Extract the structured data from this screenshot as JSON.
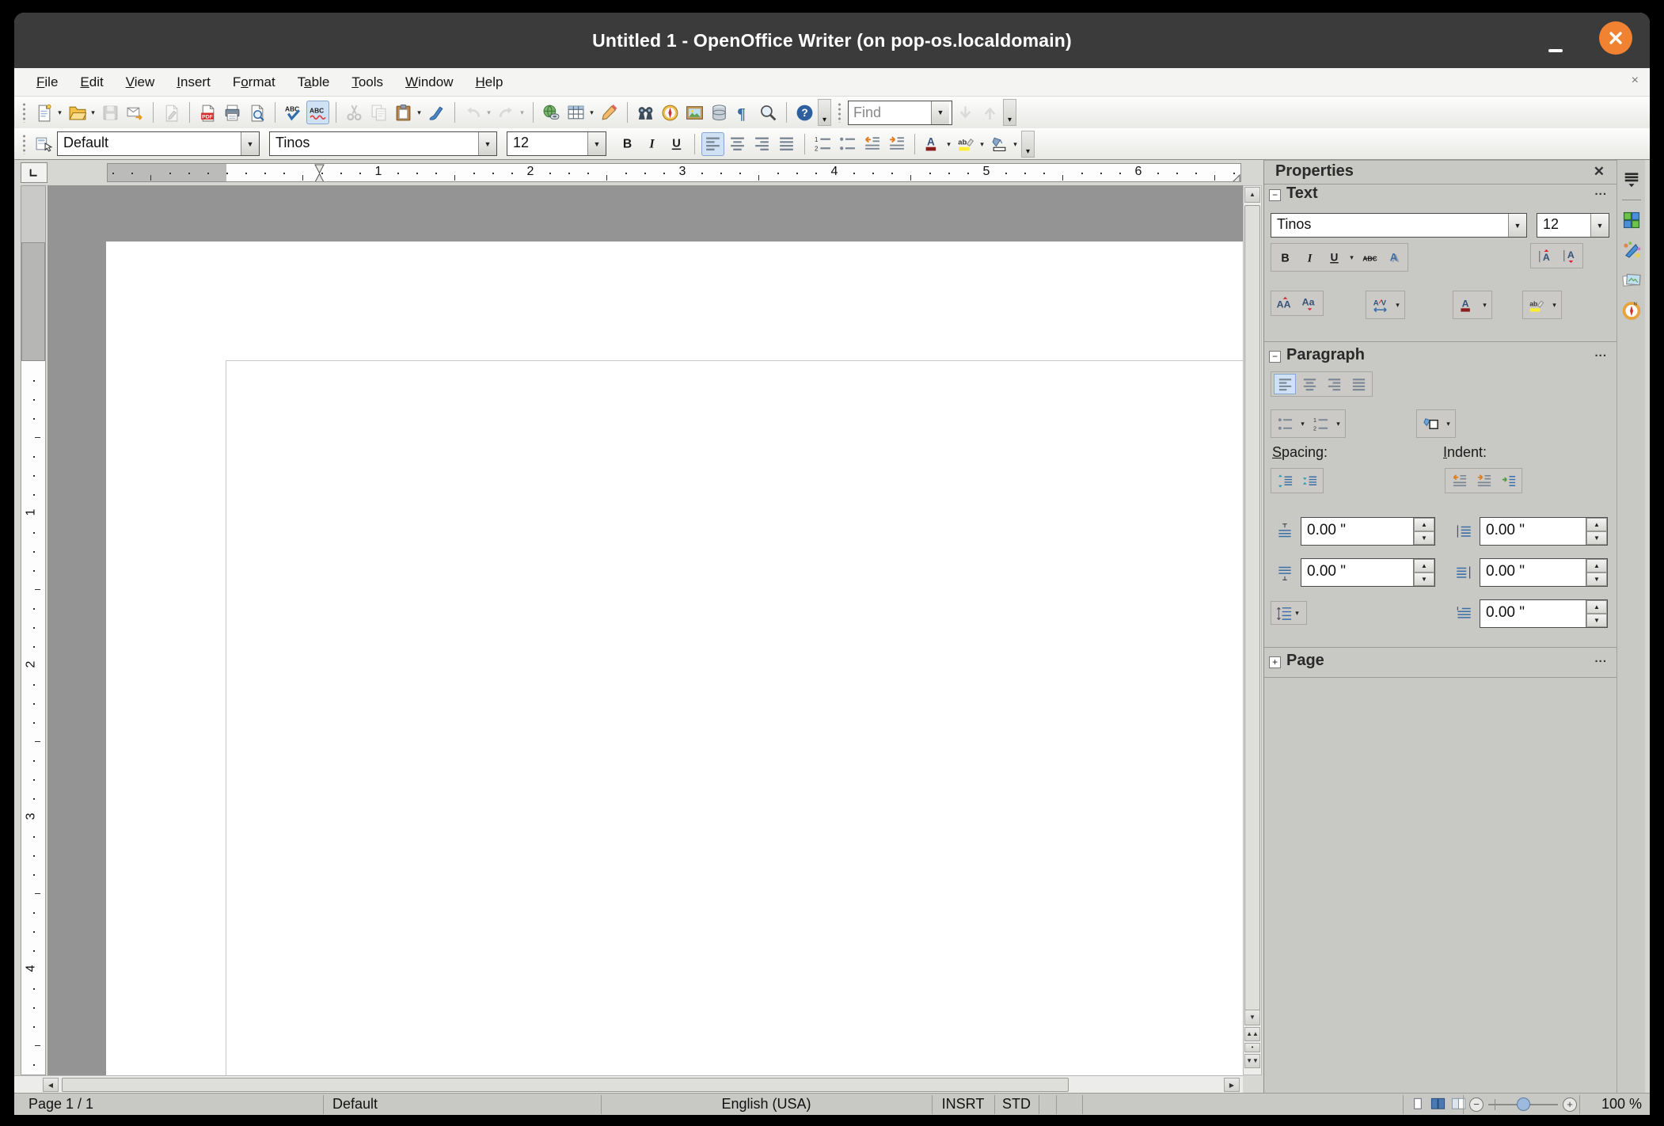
{
  "window": {
    "title": "Untitled 1 - OpenOffice Writer (on pop-os.localdomain)",
    "accent_close_color": "#f08232",
    "titlebar_color": "#3b3b3b"
  },
  "menubar": {
    "items": [
      {
        "label": "File",
        "u": 0
      },
      {
        "label": "Edit",
        "u": 0
      },
      {
        "label": "View",
        "u": 0
      },
      {
        "label": "Insert",
        "u": 0
      },
      {
        "label": "Format",
        "u": 1
      },
      {
        "label": "Table",
        "u": 1
      },
      {
        "label": "Tools",
        "u": 0
      },
      {
        "label": "Window",
        "u": 0
      },
      {
        "label": "Help",
        "u": 0
      }
    ],
    "close_document": "×"
  },
  "toolbar_main": {
    "items": [
      {
        "t": "handle"
      },
      {
        "name": "new-document",
        "dd": true
      },
      {
        "name": "open",
        "dd": true
      },
      {
        "name": "save",
        "disabled": true
      },
      {
        "name": "document-as-email"
      },
      {
        "t": "sep"
      },
      {
        "name": "edit-file",
        "disabled": true
      },
      {
        "t": "sep"
      },
      {
        "name": "export-pdf"
      },
      {
        "name": "print"
      },
      {
        "name": "page-preview"
      },
      {
        "t": "sep"
      },
      {
        "name": "spellcheck"
      },
      {
        "name": "auto-spellcheck",
        "active": true
      },
      {
        "t": "sep"
      },
      {
        "name": "cut",
        "disabled": true
      },
      {
        "name": "copy",
        "disabled": true
      },
      {
        "name": "paste",
        "dd": true
      },
      {
        "name": "format-paintbrush"
      },
      {
        "t": "sep"
      },
      {
        "name": "undo",
        "disabled": true,
        "dd": true
      },
      {
        "name": "redo",
        "disabled": true,
        "dd": true
      },
      {
        "t": "sep"
      },
      {
        "name": "hyperlink"
      },
      {
        "name": "table",
        "dd": true
      },
      {
        "name": "draw-functions"
      },
      {
        "t": "sep"
      },
      {
        "name": "find-replace"
      },
      {
        "name": "navigator"
      },
      {
        "name": "gallery"
      },
      {
        "name": "data-sources"
      },
      {
        "name": "formatting-marks"
      },
      {
        "name": "zoom"
      },
      {
        "t": "sep"
      },
      {
        "name": "help"
      },
      {
        "t": "overflow"
      },
      {
        "t": "handle"
      },
      {
        "t": "find"
      },
      {
        "name": "find-down",
        "disabled": true
      },
      {
        "name": "find-up",
        "disabled": true
      },
      {
        "t": "overflow"
      }
    ]
  },
  "find": {
    "placeholder": "Find"
  },
  "toolbar_format": {
    "style_value": "Default",
    "font_value": "Tinos",
    "size_value": "12",
    "items": [
      {
        "name": "bold"
      },
      {
        "name": "italic"
      },
      {
        "name": "underline"
      },
      {
        "t": "sep"
      },
      {
        "name": "align-left",
        "active": true
      },
      {
        "name": "align-center"
      },
      {
        "name": "align-right"
      },
      {
        "name": "align-justify"
      },
      {
        "t": "sep"
      },
      {
        "name": "numbering"
      },
      {
        "name": "bullets"
      },
      {
        "name": "decrease-indent"
      },
      {
        "name": "increase-indent"
      },
      {
        "t": "sep"
      },
      {
        "name": "font-color",
        "dd": true
      },
      {
        "name": "highlighting",
        "dd": true
      },
      {
        "name": "background-color",
        "dd": true
      },
      {
        "t": "overflow"
      }
    ]
  },
  "ruler": {
    "h_numbers": [
      "1",
      "2",
      "3",
      "4",
      "5",
      "6"
    ],
    "v_numbers": [
      "1",
      "2",
      "3",
      "4"
    ]
  },
  "properties": {
    "title": "Properties",
    "text": {
      "label": "Text",
      "font_value": "Tinos",
      "size_value": "12"
    },
    "paragraph": {
      "label": "Paragraph",
      "spacing_label": "Spacing:",
      "indent_label": "Indent:",
      "values": {
        "above": "0.00 \"",
        "below": "0.00 \"",
        "before": "0.00 \"",
        "after": "0.00 \"",
        "first_line": "0.00 \""
      }
    },
    "page": {
      "label": "Page"
    }
  },
  "statusbar": {
    "page": "Page 1 / 1",
    "page_style": "Default",
    "language": "English (USA)",
    "insert_mode": "INSRT",
    "selection_mode": "STD",
    "zoom_value": "100 %"
  }
}
